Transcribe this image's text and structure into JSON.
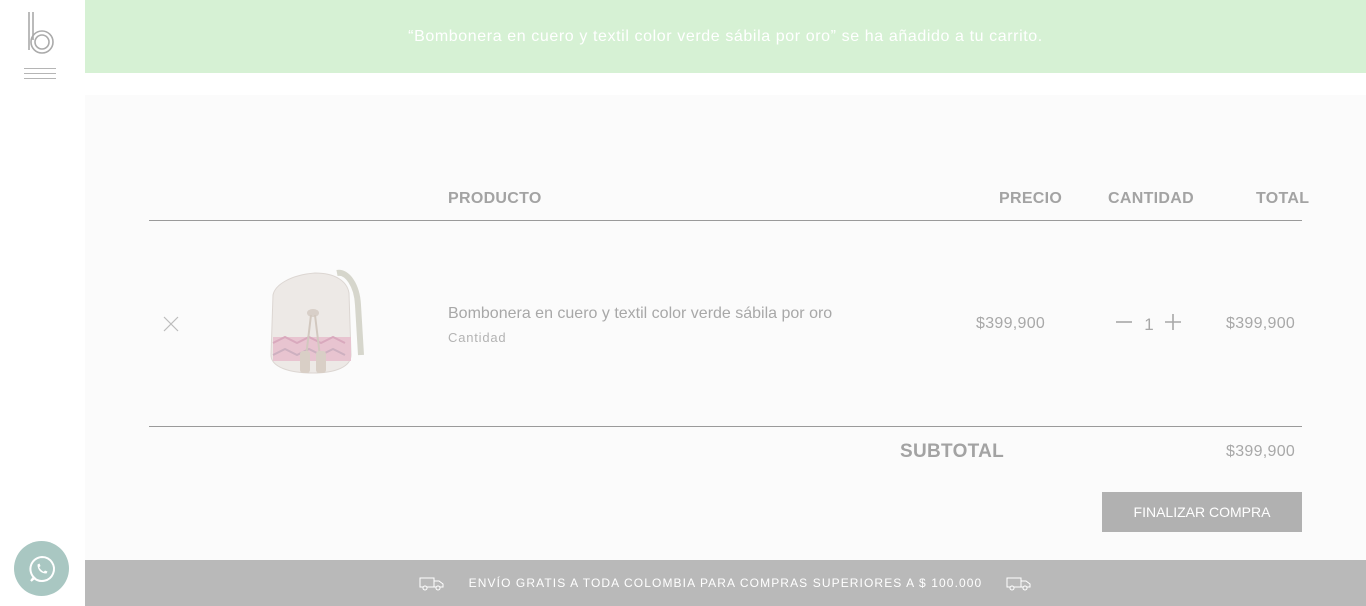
{
  "notice": {
    "message": "“Bombonera en cuero y textil color verde sábila por oro” se ha añadido a tu carrito."
  },
  "cart": {
    "headers": {
      "product": "PRODUCTO",
      "price": "PRECIO",
      "quantity": "CANTIDAD",
      "total": "TOTAL"
    },
    "items": [
      {
        "name": "Bombonera en cuero y textil color verde sábila por oro",
        "sub_label": "Cantidad",
        "price": "$399,900",
        "quantity": "1",
        "total": "$399,900"
      }
    ],
    "subtotal_label": "SUBTOTAL",
    "subtotal_value": "$399,900",
    "checkout_label": "FINALIZAR COMPRA"
  },
  "shipping_bar": {
    "text": "ENVÍO GRATIS A TODA COLOMBIA PARA COMPRAS SUPERIORES A $ 100.000"
  },
  "icons": {
    "logo": "logo-b-icon",
    "menu": "hamburger-menu-icon",
    "remove": "close-icon",
    "decrease": "minus-icon",
    "increase": "plus-icon",
    "truck": "delivery-truck-icon",
    "whatsapp": "whatsapp-icon"
  },
  "colors": {
    "notice_bg": "#d6f1d4",
    "main_bg": "#fbfbfb",
    "checkout_bg": "#b1b1b1",
    "shipbar_bg": "#b9b9b9",
    "whatsapp_bg": "#a9c7c2"
  }
}
